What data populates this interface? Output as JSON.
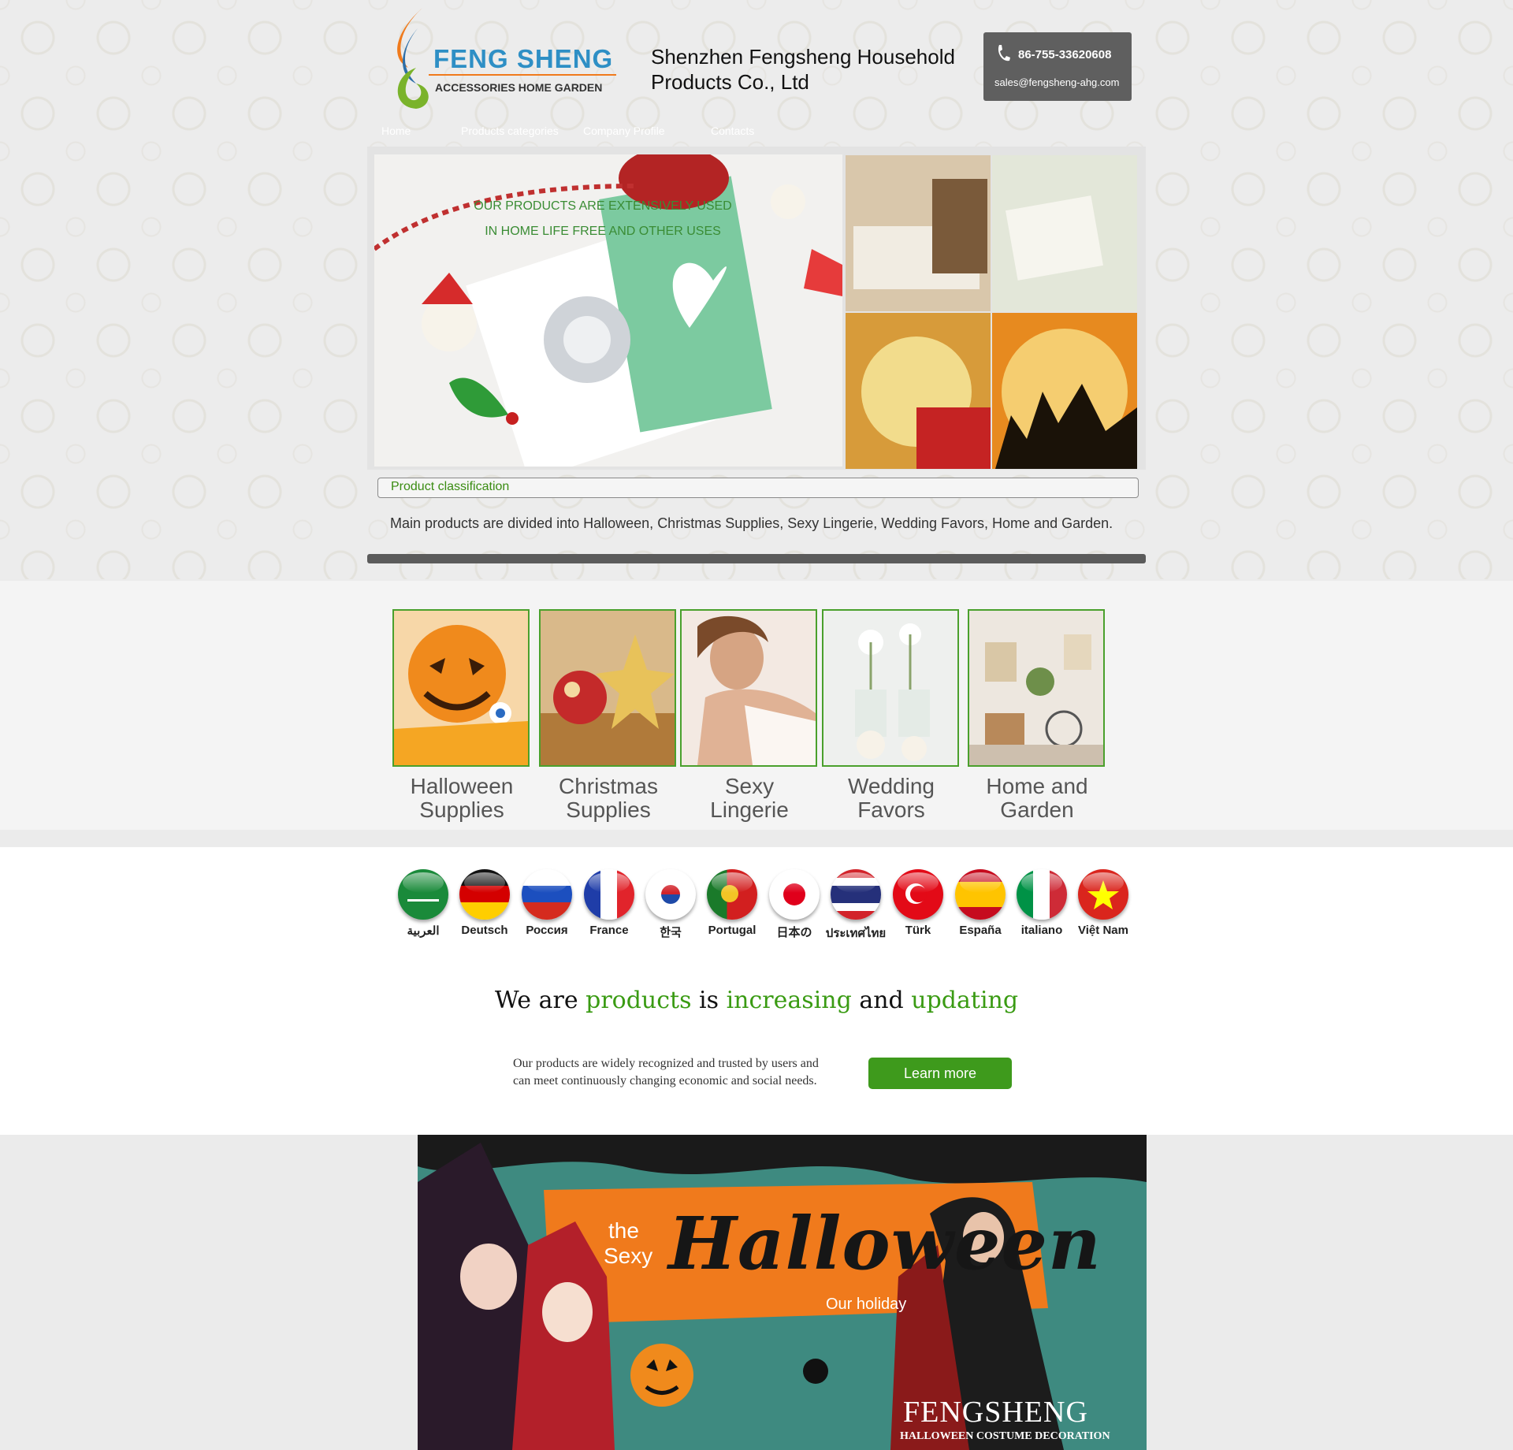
{
  "header": {
    "logo_name": "FENG SHENG",
    "logo_tagline": "ACCESSORIES HOME GARDEN",
    "company_line1": "Shenzhen Fengsheng Household",
    "company_line2": "Products Co., Ltd",
    "phone": "86-755-33620608",
    "email": "sales@fengsheng-ahg.com"
  },
  "nav": {
    "items": [
      {
        "label": "Home"
      },
      {
        "label": "Products categories"
      },
      {
        "label": "Company Profile"
      },
      {
        "label": "Contacts"
      }
    ]
  },
  "banner": {
    "line1": "OUR PRODUCTS ARE EXTENSIVELY USED",
    "line2": "IN HOME LIFE FREE AND OTHER USES"
  },
  "classification": {
    "title": "Product classification",
    "text": "Main products are divided into Halloween, Christmas Supplies, Sexy Lingerie, Wedding Favors, Home and Garden."
  },
  "categories": [
    {
      "line1": "Halloween",
      "line2": "Supplies"
    },
    {
      "line1": "Christmas",
      "line2": "Supplies"
    },
    {
      "line1": "Sexy",
      "line2": "Lingerie"
    },
    {
      "line1": "Wedding",
      "line2": "Favors"
    },
    {
      "line1": "Home and",
      "line2": "Garden"
    }
  ],
  "languages": [
    {
      "label": "العربية",
      "icon": "saudi-flag-icon"
    },
    {
      "label": "Deutsch",
      "icon": "germany-flag-icon"
    },
    {
      "label": "Россия",
      "icon": "russia-flag-icon"
    },
    {
      "label": "France",
      "icon": "france-flag-icon"
    },
    {
      "label": "한국",
      "icon": "korea-flag-icon"
    },
    {
      "label": "Portugal",
      "icon": "portugal-flag-icon"
    },
    {
      "label": "日本の",
      "icon": "japan-flag-icon"
    },
    {
      "label": "ประเทศไทย",
      "icon": "thailand-flag-icon"
    },
    {
      "label": "Türk",
      "icon": "turkey-flag-icon"
    },
    {
      "label": "España",
      "icon": "spain-flag-icon"
    },
    {
      "label": "italiano",
      "icon": "italy-flag-icon"
    },
    {
      "label": "Việt Nam",
      "icon": "vietnam-flag-icon"
    }
  ],
  "promo": {
    "w1": "We are ",
    "w2": "products",
    "w3": " is ",
    "w4": "increasing",
    "w5": " and ",
    "w6": "updating",
    "text_line1": "Our products are widely recognized and trusted by users and",
    "text_line2": "can meet continuously changing economic and social needs.",
    "button": "Learn more"
  },
  "halloween_banner": {
    "the": "the",
    "sexy": "Sexy",
    "title": "Halloween",
    "subtitle": "Our holiday",
    "brand": "FENGSHENG",
    "brand_sub": "HALLOWEEN COSTUME DECORATION"
  },
  "colors": {
    "accent_green": "#3e9a1c",
    "contact_bg": "#5f5f5f",
    "halloween_orange": "#f07a1c"
  }
}
